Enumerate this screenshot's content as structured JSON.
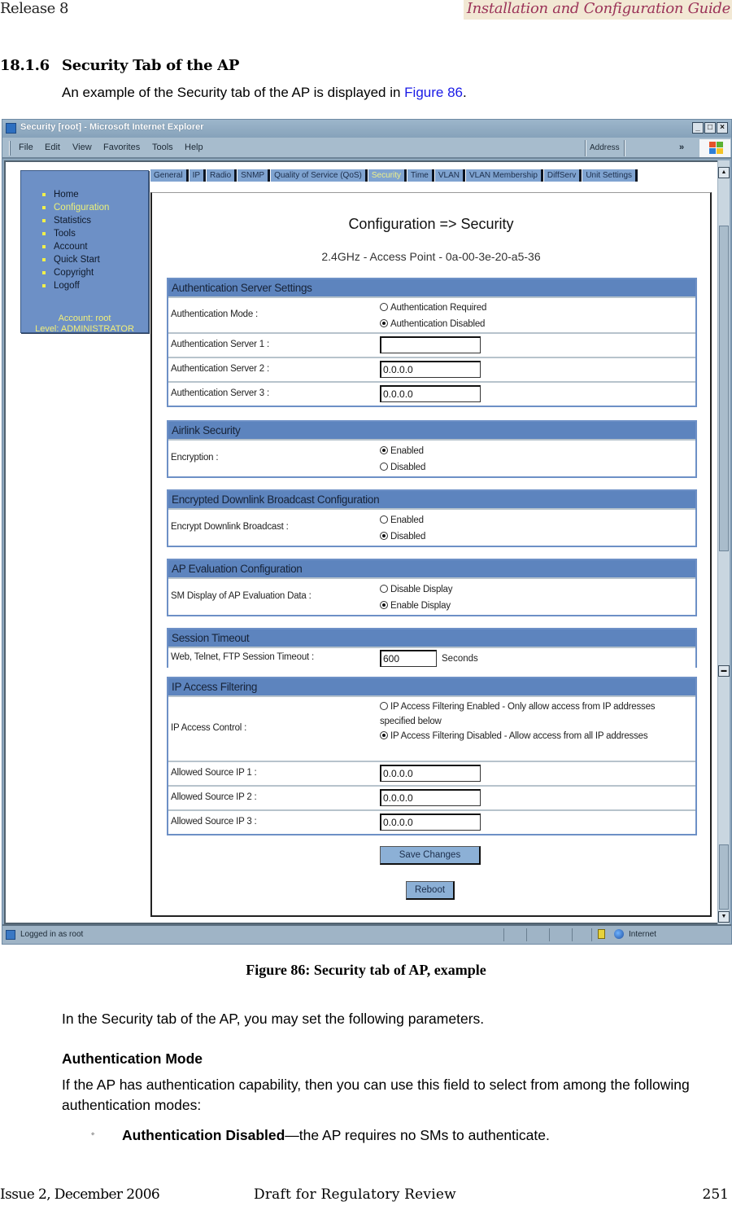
{
  "page_header": {
    "release": "Release 8",
    "guide_title": "Installation and Configuration Guide"
  },
  "section": {
    "number": "18.1.6",
    "title": "Security Tab of the AP",
    "intro_before": "An example of the Security tab of the AP is displayed in ",
    "intro_link": "Figure 86",
    "intro_after": "."
  },
  "browser": {
    "window_title": "Security [root] - Microsoft Internet Explorer",
    "window_buttons": [
      "_",
      "□",
      "×"
    ],
    "menu": [
      "File",
      "Edit",
      "View",
      "Favorites",
      "Tools",
      "Help"
    ],
    "address_label": "Address",
    "more_chevron": "»",
    "status_text": "Logged in as root",
    "zone_text": "Internet"
  },
  "webpage": {
    "nav": {
      "items": [
        "Home",
        "Configuration",
        "Statistics",
        "Tools",
        "Account",
        "Quick Start",
        "Copyright",
        "Logoff"
      ],
      "active_index": 1,
      "account_line": "Account: root",
      "level_line": "Level: ADMINISTRATOR"
    },
    "tabs": [
      "General",
      "IP",
      "Radio",
      "SNMP",
      "Quality of Service (QoS)",
      "Security",
      "Time",
      "VLAN",
      "VLAN Membership",
      "DiffServ",
      "Unit Settings"
    ],
    "active_tab": "Security",
    "title": "Configuration => Security",
    "subtitle": "2.4GHz - Access Point - 0a-00-3e-20-a5-36",
    "sections": {
      "auth": {
        "header": "Authentication Server Settings",
        "mode_label": "Authentication Mode :",
        "mode_options": [
          "Authentication Required",
          "Authentication Disabled"
        ],
        "mode_selected": "Authentication Disabled",
        "server1_label": "Authentication Server 1 :",
        "server1_value": "",
        "server2_label": "Authentication Server 2 :",
        "server2_value": "0.0.0.0",
        "server3_label": "Authentication Server 3 :",
        "server3_value": "0.0.0.0"
      },
      "airlink": {
        "header": "Airlink Security",
        "label": "Encryption :",
        "options": [
          "Enabled",
          "Disabled"
        ],
        "selected": "Enabled"
      },
      "downlink": {
        "header": "Encrypted Downlink Broadcast Configuration",
        "label": "Encrypt Downlink Broadcast :",
        "options": [
          "Enabled",
          "Disabled"
        ],
        "selected": "Disabled"
      },
      "ap_eval": {
        "header": "AP Evaluation Configuration",
        "label": "SM Display of AP Evaluation Data :",
        "options": [
          "Disable Display",
          "Enable Display"
        ],
        "selected": "Enable Display"
      },
      "session": {
        "header": "Session Timeout",
        "label": "Web, Telnet, FTP Session Timeout :",
        "value": "600",
        "unit": "Seconds"
      },
      "ipf": {
        "header": "IP Access Filtering",
        "label": "IP Access Control :",
        "options": [
          "IP Access Filtering Enabled - Only allow access from IP addresses specified below",
          "IP Access Filtering Disabled - Allow access from all IP addresses"
        ],
        "selected": "IP Access Filtering Disabled - Allow access from all IP addresses",
        "ip1_label": "Allowed Source IP 1 :",
        "ip1_value": "0.0.0.0",
        "ip2_label": "Allowed Source IP 2 :",
        "ip2_value": "0.0.0.0",
        "ip3_label": "Allowed Source IP 3 :",
        "ip3_value": "0.0.0.0"
      }
    },
    "save_button": "Save Changes",
    "reboot_button": "Reboot"
  },
  "figure_caption": "Figure 86: Security tab of AP, example",
  "body": {
    "para1": "In the Security tab of the AP, you may set the following parameters.",
    "heading": "Authentication Mode",
    "para2": "If the AP has authentication capability, then you can use this field to select from among the following authentication modes:",
    "bullet_marker": "◦",
    "bullet_bold": "Authentication Disabled",
    "bullet_rest": "—the AP requires no SMs to authenticate."
  },
  "page_footer": {
    "issue": "Issue 2, December 2006",
    "draft": "Draft for Regulatory Review",
    "page_number": "251"
  },
  "colors": {
    "guide_title": "#9b3358",
    "guide_title_bg": "#f2e8d4",
    "link": "#1a1ae6",
    "section_header": "#5d84be",
    "nav_bg": "#6d90c6",
    "nav_active": "#eaf07a"
  }
}
